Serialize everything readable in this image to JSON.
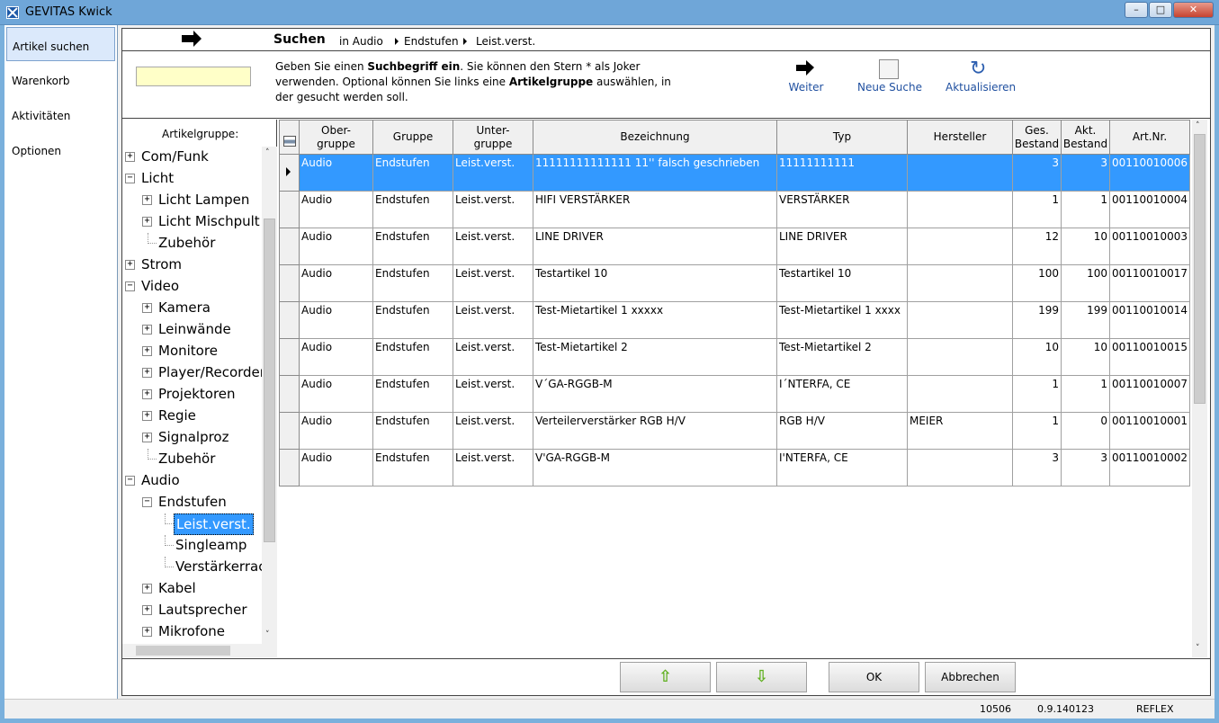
{
  "window": {
    "title": "GEVITAS Kwick"
  },
  "nav": {
    "items": [
      {
        "label": "Artikel suchen"
      },
      {
        "label": "Warenkorb"
      },
      {
        "label": "Aktivitäten"
      },
      {
        "label": "Optionen"
      }
    ]
  },
  "header": {
    "title": "Suchen",
    "breadcrumb": [
      "in Audio",
      "Endstufen",
      "Leist.verst."
    ]
  },
  "search": {
    "value": "",
    "help_parts": [
      "Geben Sie einen ",
      "Suchbegriff ein",
      ". Sie können den Stern * als Joker verwenden. Optional können Sie links eine ",
      "Artikelgruppe",
      " auswählen, in der gesucht werden soll."
    ],
    "tools": {
      "next": "Weiter",
      "new_search": "Neue Suche",
      "refresh": "Aktualisieren"
    }
  },
  "tree": {
    "title": "Artikelgruppe:",
    "nodes": [
      {
        "label": "Com/Funk",
        "level": 0,
        "state": "plus"
      },
      {
        "label": "Licht",
        "level": 0,
        "state": "minus"
      },
      {
        "label": "Licht Lampen",
        "level": 1,
        "state": "plus"
      },
      {
        "label": "Licht Mischpult",
        "level": 1,
        "state": "plus"
      },
      {
        "label": "Zubehör",
        "level": 1,
        "state": "leaf"
      },
      {
        "label": "Strom",
        "level": 0,
        "state": "plus"
      },
      {
        "label": "Video",
        "level": 0,
        "state": "minus"
      },
      {
        "label": "Kamera",
        "level": 1,
        "state": "plus"
      },
      {
        "label": "Leinwände",
        "level": 1,
        "state": "plus"
      },
      {
        "label": "Monitore",
        "level": 1,
        "state": "plus"
      },
      {
        "label": "Player/Recorder",
        "level": 1,
        "state": "plus"
      },
      {
        "label": "Projektoren",
        "level": 1,
        "state": "plus"
      },
      {
        "label": "Regie",
        "level": 1,
        "state": "plus"
      },
      {
        "label": "Signalproz",
        "level": 1,
        "state": "plus"
      },
      {
        "label": "Zubehör",
        "level": 1,
        "state": "leaf"
      },
      {
        "label": "Audio",
        "level": 0,
        "state": "minus"
      },
      {
        "label": "Endstufen",
        "level": 1,
        "state": "minus"
      },
      {
        "label": "Leist.verst.",
        "level": 2,
        "state": "leaf",
        "selected": true
      },
      {
        "label": "Singleamp",
        "level": 2,
        "state": "leaf"
      },
      {
        "label": "Verstärkerrac",
        "level": 2,
        "state": "leaf"
      },
      {
        "label": "Kabel",
        "level": 1,
        "state": "plus"
      },
      {
        "label": "Lautsprecher",
        "level": 1,
        "state": "plus"
      },
      {
        "label": "Mikrofone",
        "level": 1,
        "state": "plus"
      }
    ]
  },
  "grid": {
    "columns": [
      "Ober-\ngruppe",
      "Gruppe",
      "Unter-\ngruppe",
      "Bezeichnung",
      "Typ",
      "Hersteller",
      "Ges.\nBestand",
      "Akt.\nBestand",
      "Art.Nr."
    ],
    "rows": [
      [
        "Audio",
        "Endstufen",
        "Leist.verst.",
        "11111111111111 11'' falsch geschrieben",
        "11111111111",
        "",
        "3",
        "3",
        "00110010006"
      ],
      [
        "Audio",
        "Endstufen",
        "Leist.verst.",
        "HIFI VERSTÄRKER",
        "VERSTÄRKER",
        "",
        "1",
        "1",
        "00110010004"
      ],
      [
        "Audio",
        "Endstufen",
        "Leist.verst.",
        "LINE DRIVER",
        "LINE DRIVER",
        "",
        "12",
        "10",
        "00110010003"
      ],
      [
        "Audio",
        "Endstufen",
        "Leist.verst.",
        "Testartikel 10",
        "Testartikel 10",
        "",
        "100",
        "100",
        "00110010017"
      ],
      [
        "Audio",
        "Endstufen",
        "Leist.verst.",
        "Test-Mietartikel 1 xxxxx",
        "Test-Mietartikel 1 xxxx",
        "",
        "199",
        "199",
        "00110010014"
      ],
      [
        "Audio",
        "Endstufen",
        "Leist.verst.",
        "Test-Mietartikel 2",
        "Test-Mietartikel 2",
        "",
        "10",
        "10",
        "00110010015"
      ],
      [
        "Audio",
        "Endstufen",
        "Leist.verst.",
        "V´GA-RGGB-M",
        "I´NTERFA, CE",
        "",
        "1",
        "1",
        "00110010007"
      ],
      [
        "Audio",
        "Endstufen",
        "Leist.verst.",
        "Verteilerverstärker RGB H/V",
        "RGB H/V",
        "MEIER",
        "1",
        "0",
        "00110010001"
      ],
      [
        "Audio",
        "Endstufen",
        "Leist.verst.",
        "V'GA-RGGB-M",
        "I'NTERFA, CE",
        "",
        "3",
        "3",
        "00110010002"
      ]
    ],
    "selected_row": 0
  },
  "buttons": {
    "up": "⇧",
    "down": "⇩",
    "ok": "OK",
    "cancel": "Abbrechen"
  },
  "status": {
    "code": "10506",
    "version": "0.9.140123",
    "product": "REFLEX"
  },
  "colors": {
    "selection": "#3399ff",
    "input_bg": "#ffffc8",
    "title_bar": "#6fa6d8"
  }
}
